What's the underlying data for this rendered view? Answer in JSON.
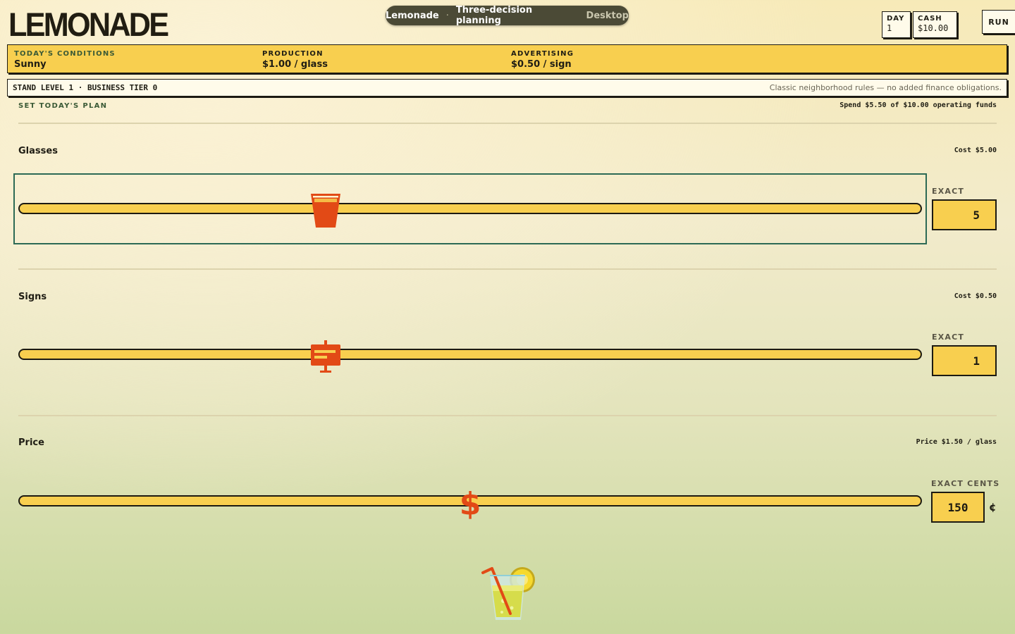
{
  "header": {
    "logo": "LEMONADE",
    "pill": {
      "title": "Lemonade",
      "separator": "·",
      "subtitle": "Three-decision planning",
      "mode": "Desktop"
    },
    "day": {
      "label": "DAY",
      "value": "1"
    },
    "cash": {
      "label": "CASH",
      "value": "$10.00"
    },
    "run_label": "RUN"
  },
  "conditions": {
    "today_label": "TODAY'S CONDITIONS",
    "today_value": "Sunny",
    "production_label": "PRODUCTION",
    "production_value": "$1.00 / glass",
    "advertising_label": "ADVERTISING",
    "advertising_value": "$0.50 / sign"
  },
  "level_bar": {
    "left": "STAND LEVEL 1 · BUSINESS TIER 0",
    "right": "Classic neighborhood rules — no added finance obligations."
  },
  "plan": {
    "heading": "SET TODAY'S PLAN",
    "spend": "Spend $5.50 of $10.00 operating funds",
    "glasses": {
      "label": "Glasses",
      "cost": "Cost $5.00",
      "exact_label": "EXACT",
      "value": "5",
      "slider_fraction": 0.34,
      "icon": "cup-icon"
    },
    "signs": {
      "label": "Signs",
      "cost": "Cost $0.50",
      "exact_label": "EXACT",
      "value": "1",
      "slider_fraction": 0.34,
      "icon": "sign-icon"
    },
    "price": {
      "label": "Price",
      "cost": "Price $1.50 / glass",
      "exact_label": "EXACT CENTS",
      "value": "150",
      "unit": "¢",
      "slider_fraction": 0.5,
      "icon": "dollar-icon"
    }
  },
  "colors": {
    "accent": "#f8cf4f",
    "thumb": "#e24a16",
    "focus": "#2c6a55",
    "ink": "#1c1a12"
  },
  "mascot": "lemonade-glass-icon"
}
